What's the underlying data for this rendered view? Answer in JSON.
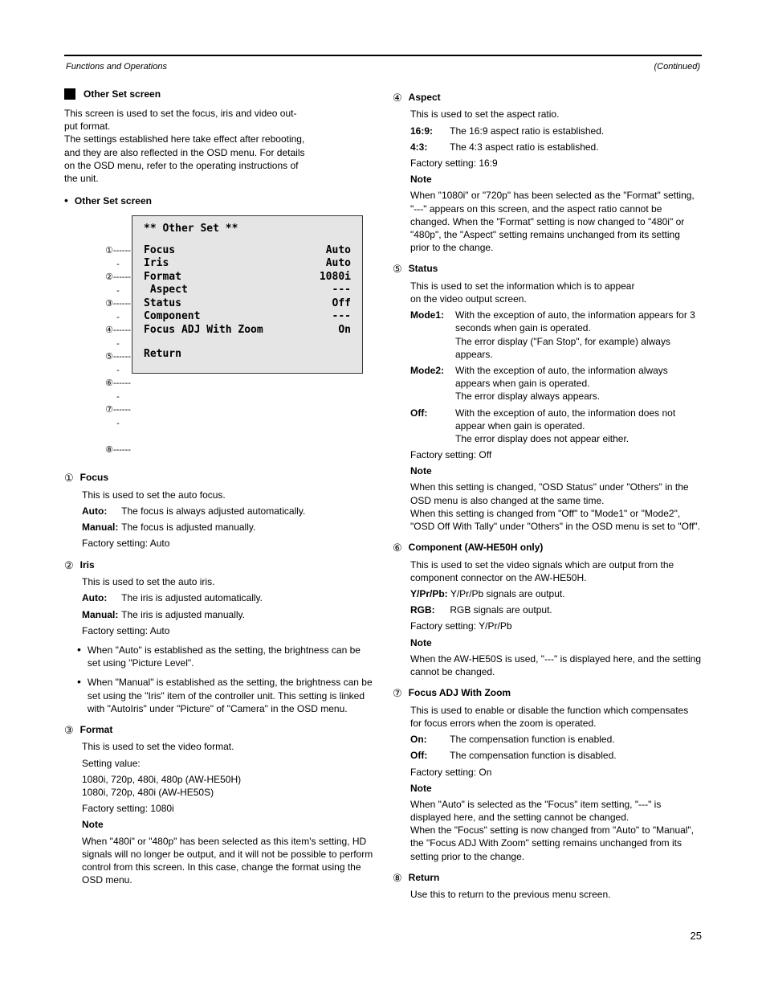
{
  "header": {
    "left_italic": "Functions and Operations",
    "right_italic": "(Continued)"
  },
  "section": {
    "title": "Other Set screen",
    "intro_line1": "This screen is used to set the focus, iris and video out-",
    "intro_line2": "put format.",
    "intro_line3": "The settings established here take effect after rebooting,",
    "intro_line4": "and they are also reflected in the OSD menu. For details",
    "intro_line5": "on the OSD menu, refer to the operating instructions of",
    "intro_line6": "the unit."
  },
  "bullet_main": "Other Set screen",
  "menu": {
    "title": " Other Set ",
    "items": [
      {
        "num": "1",
        "label": "Focus",
        "value": "Auto"
      },
      {
        "num": "2",
        "label": "Iris",
        "value": "Auto"
      },
      {
        "num": "3",
        "label": "Format",
        "value": "1080i"
      },
      {
        "num": "4",
        "label": " Aspect",
        "value": "---"
      },
      {
        "num": "5",
        "label": "Status",
        "value": "Off"
      },
      {
        "num": "6",
        "label": "Component",
        "value": "---"
      },
      {
        "num": "7",
        "label": "Focus ADJ With Zoom",
        "value": "On"
      }
    ],
    "return": {
      "num": "8",
      "label": "Return"
    }
  },
  "items": {
    "1": {
      "num": "1",
      "title": "Focus",
      "line1": "This is used to set the auto focus.",
      "defs": [
        {
          "k": "Auto:",
          "v": "The focus is always adjusted automatically."
        },
        {
          "k": "Manual:",
          "v": "The focus is adjusted manually."
        }
      ],
      "factory": "Factory setting: Auto"
    },
    "2": {
      "num": "2",
      "title": "Iris",
      "line1": "This is used to set the auto iris.",
      "defs": [
        {
          "k": "Auto:",
          "v": "The iris is adjusted automatically."
        },
        {
          "k": "Manual:",
          "v": "The iris is adjusted manually."
        }
      ],
      "factory": "Factory setting: Auto",
      "notes": [
        "When \"Auto\" is established as the setting, the brightness can be set using \"Picture Level\".",
        "When \"Manual\" is established as the setting, the brightness can be set using the \"Iris\" item of the controller unit. This setting is linked with \"AutoIris\" under \"Picture\" of \"Camera\" in the OSD menu."
      ]
    },
    "3": {
      "num": "3",
      "title": "Format",
      "line1": "This is used to set the video format.",
      "values_label": "Setting value:",
      "values": "1080i, 720p, 480i, 480p (AW-HE50H)\n1080i, 720p, 480i (AW-HE50S)",
      "factory": "Factory setting: 1080i",
      "note_label": "Note",
      "note": "When \"480i\" or \"480p\" has been selected as this item's setting, HD signals will no longer be output, and it will not be possible to perform control from this screen.\nIn this case, change the format using the OSD menu."
    },
    "4": {
      "num": "4",
      "title": "Aspect",
      "line1": "This is used to set the aspect ratio.",
      "defs": [
        {
          "k": "16:9:",
          "v": "The 16:9 aspect ratio is established."
        },
        {
          "k": "4:3:",
          "v": "The 4:3 aspect ratio is established."
        }
      ],
      "factory": "Factory setting: 16:9",
      "note_label": "Note",
      "note": "When \"1080i\" or \"720p\" has been selected as the \"Format\" setting, \"---\" appears on this screen, and the aspect ratio cannot be changed. When the \"Format\" setting is now changed to \"480i\" or \"480p\", the \"Aspect\" setting remains unchanged from its setting prior to the change."
    },
    "5": {
      "num": "5",
      "title": "Status",
      "line1_a": "This is used to set the information which is to appear",
      "line1_b": "on the video output screen.",
      "defs": [
        {
          "k": "Mode1:",
          "v": "With the exception of auto, the information appears for 3 seconds when gain is operated.\nThe error display (\"Fan Stop\", for example) always appears."
        },
        {
          "k": "Mode2:",
          "v": "With the exception of auto, the information always appears when gain is operated.\nThe error display always appears."
        },
        {
          "k": "Off:",
          "v": "With the exception of auto, the information does not appear when gain is operated.\nThe error display does not appear either."
        }
      ],
      "factory": "Factory setting: Off",
      "note_label": "Note",
      "note": "When this setting is changed, \"OSD Status\" under \"Others\" in the OSD menu is also changed at the same time.\nWhen this setting is changed from \"Off\" to \"Mode1\" or \"Mode2\", \"OSD Off With Tally\" under \"Others\" in the OSD menu is set to \"Off\"."
    },
    "6": {
      "num": "6",
      "title": "Component (AW-HE50H only)",
      "line1": "This is used to set the video signals which are output from the component connector on the AW-HE50H.",
      "defs": [
        {
          "k": "Y/Pr/Pb:",
          "v": "Y/Pr/Pb signals are output."
        },
        {
          "k": "RGB:",
          "v": "RGB signals are output."
        }
      ],
      "factory": "Factory setting: Y/Pr/Pb",
      "note_label": "Note",
      "note": "When the AW-HE50S is used, \"---\" is displayed here, and the setting cannot be changed."
    },
    "7": {
      "num": "7",
      "title": "Focus ADJ With Zoom",
      "line1": "This is used to enable or disable the function which compensates for focus errors when the zoom is operated.",
      "defs": [
        {
          "k": "On:",
          "v": "The compensation function is enabled."
        },
        {
          "k": "Off:",
          "v": "The compensation function is disabled."
        }
      ],
      "factory": "Factory setting: On",
      "note_label": "Note",
      "note": "When \"Auto\" is selected as the \"Focus\" item setting, \"---\" is displayed here, and the setting cannot be changed.\nWhen the \"Focus\" setting is now changed from \"Auto\" to \"Manual\", the \"Focus ADJ With Zoom\" setting remains unchanged from its setting prior to the change."
    },
    "8": {
      "num": "8",
      "title": "Return",
      "line1": "Use this to return to the previous menu screen."
    }
  },
  "footer": "25"
}
